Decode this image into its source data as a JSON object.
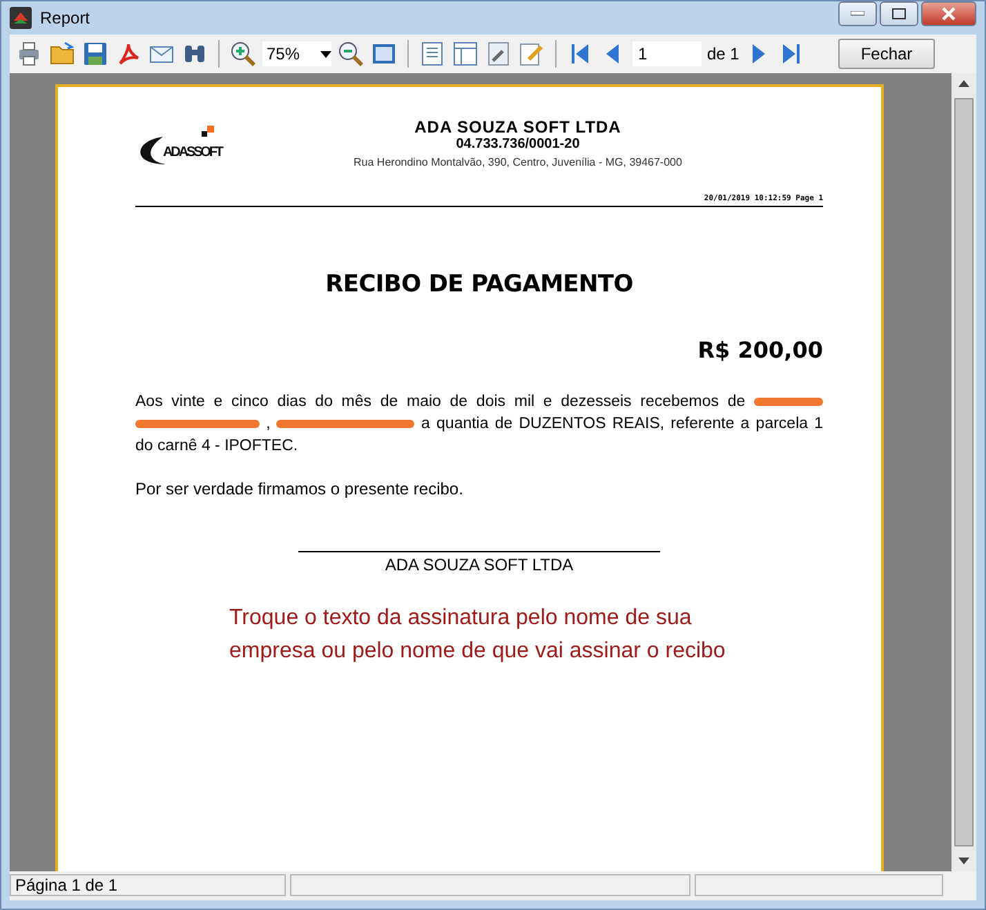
{
  "window": {
    "title": "Report"
  },
  "toolbar": {
    "zoom": "75%",
    "page_input": "1",
    "page_total": "de 1",
    "close_button": "Fechar"
  },
  "report": {
    "logo_text": "ADASSOFT",
    "company": "ADA SOUZA SOFT LTDA",
    "cnpj": "04.733.736/0001-20",
    "address": "Rua Herondino Montalvão, 390, Centro, Juvenília - MG, 39467-000",
    "timestamp": "20/01/2019 10:12:59 Page 1",
    "title": "RECIBO DE PAGAMENTO",
    "amount": "R$ 200,00",
    "paragraph": [
      {
        "kind": "text",
        "text": "Aos vinte e cinco dias do mês de maio de dois mil e dezesseis recebemos de"
      },
      {
        "kind": "redaction"
      },
      {
        "kind": "redaction"
      },
      {
        "kind": "text",
        "text": ","
      },
      {
        "kind": "redaction"
      },
      {
        "kind": "text",
        "text": "a quantia de DUZENTOS REAIS, referente a parcela 1 do carnê 4 - IPOFTEC."
      }
    ],
    "closing": "Por ser verdade firmamos o presente recibo.",
    "signature": "ADA SOUZA SOFT LTDA",
    "note": "Troque o texto da assinatura pelo nome de sua empresa ou pelo nome de que vai assinar o recibo"
  },
  "status_bar": {
    "panel_1": "Página 1 de 1"
  }
}
